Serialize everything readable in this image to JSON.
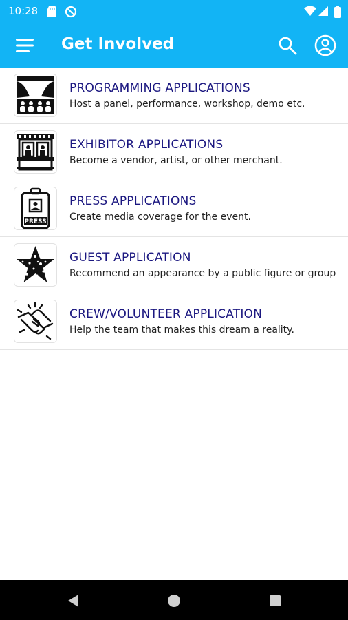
{
  "status_bar": {
    "time": "10:28",
    "icons": [
      "sd-card-icon",
      "sync-off-icon",
      "wifi-icon",
      "signal-icon",
      "battery-icon"
    ]
  },
  "app_bar": {
    "title": "Get Involved",
    "background": "#12b4f5",
    "icons": [
      "menu-icon",
      "search-icon",
      "account-icon"
    ]
  },
  "items": [
    {
      "title": "PROGRAMMING APPLICATIONS",
      "subtitle": "Host a panel, performance, workshop, demo etc.",
      "icon": "stage-audience-icon"
    },
    {
      "title": "EXHIBITOR APPLICATIONS",
      "subtitle": "Become a vendor, artist, or other merchant.",
      "icon": "storefront-icon"
    },
    {
      "title": "PRESS APPLICATIONS",
      "subtitle": "Create media coverage for the event.",
      "icon": "press-badge-icon"
    },
    {
      "title": "GUEST APPLICATION",
      "subtitle": "Recommend an appearance by a public figure or group",
      "icon": "star-icon"
    },
    {
      "title": "CREW/VOLUNTEER APPLICATION",
      "subtitle": "Help the team that makes this dream a reality.",
      "icon": "handshake-icon"
    }
  ],
  "colors": {
    "title_text": "#1b1780",
    "accent": "#12b4f5"
  },
  "nav_bar": {
    "icons": [
      "back-icon",
      "home-icon",
      "recents-icon"
    ]
  }
}
